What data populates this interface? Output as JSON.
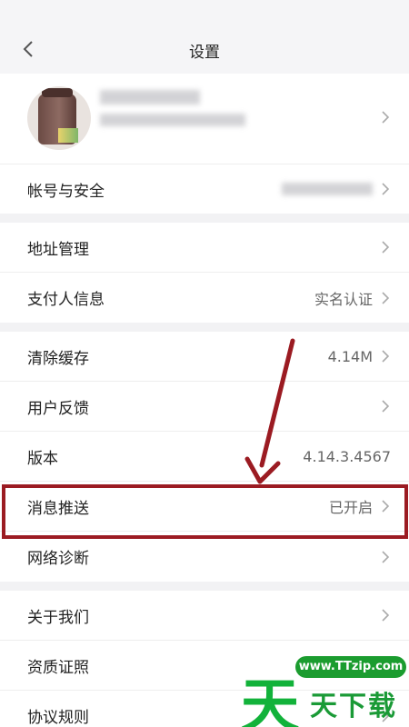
{
  "nav": {
    "title": "设置",
    "back_icon": "chevron-left-icon"
  },
  "account_row": {
    "label": "帐号与安全"
  },
  "group2": [
    {
      "label": "地址管理",
      "value": ""
    },
    {
      "label": "支付人信息",
      "value": "实名认证"
    }
  ],
  "group3": [
    {
      "label": "清除缓存",
      "value": "4.14M",
      "chevron": true
    },
    {
      "label": "用户反馈",
      "value": "",
      "chevron": true
    },
    {
      "label": "版本",
      "value": "4.14.3.4567",
      "chevron": false
    },
    {
      "label": "消息推送",
      "value": "已开启",
      "chevron": true
    },
    {
      "label": "网络诊断",
      "value": "",
      "chevron": true
    }
  ],
  "group4": [
    {
      "label": "关于我们"
    },
    {
      "label": "资质证照"
    },
    {
      "label": "协议规则"
    }
  ],
  "watermark": {
    "url": "www.TTzip.com",
    "big": "天",
    "text": "天下载"
  },
  "colors": {
    "highlight": "#9b1b22",
    "watermark": "#12b23a"
  }
}
